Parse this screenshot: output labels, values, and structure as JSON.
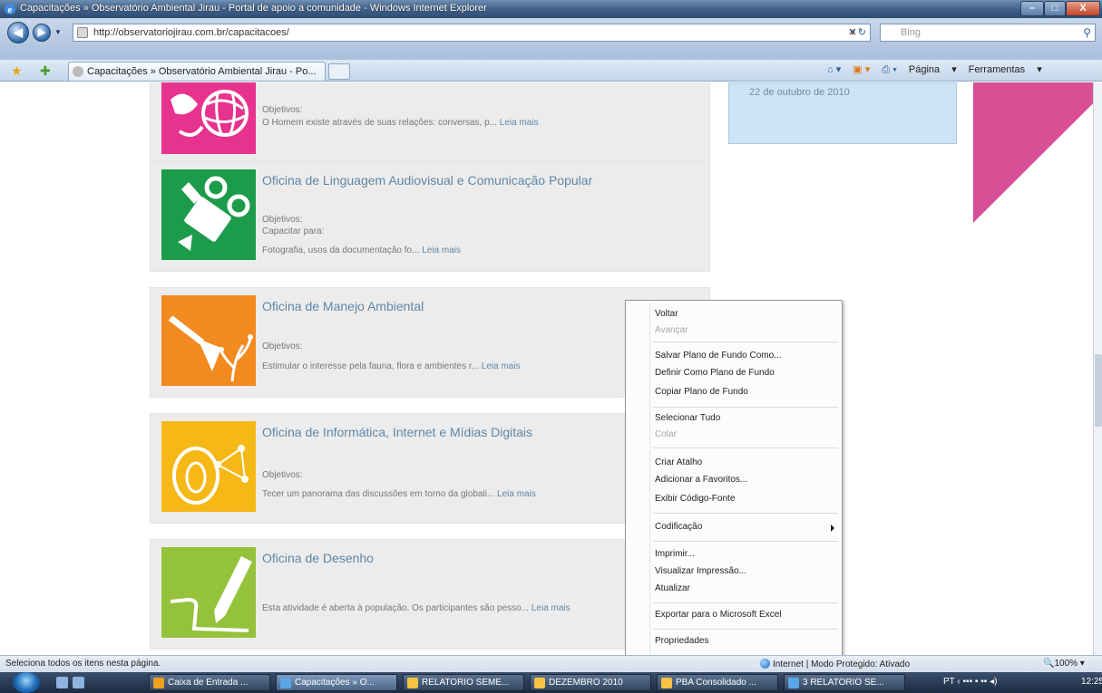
{
  "window": {
    "title": "Capacitações » Observatório Ambiental Jirau - Portal de apoio a comunidade - Windows Internet Explorer",
    "min_label": "–",
    "max_label": "□",
    "close_label": "X"
  },
  "addressbar": {
    "url": "http://observatoriojirau.com.br/capacitacoes/",
    "search_placeholder": "Bing"
  },
  "tab": {
    "label": "Capacitações » Observatório Ambiental Jirau - Po..."
  },
  "commandbar": {
    "page_label": "Página",
    "tools_label": "Ferramentas"
  },
  "sidebar": {
    "date": "22 de outubro de 2010"
  },
  "cards": [
    {
      "title": "",
      "objetivos_label": "Objetivos:",
      "line": "",
      "description": "O Homem existe através de suas relações: conversas, p...",
      "more": "Leia mais",
      "color": "#e6338e"
    },
    {
      "title": "Oficina de Linguagem Audiovisual e Comunicação Popular",
      "objetivos_label": "Objetivos:",
      "line": "Capacitar para:",
      "description": "Fotografia, usos da documentação fo...",
      "more": "Leia mais",
      "color": "#1c9c4a"
    },
    {
      "title": "Oficina de Manejo Ambiental",
      "objetivos_label": "Objetivos:",
      "line": "",
      "description": "Estimular o interesse pela fauna, flora e ambientes r...",
      "more": "Leia mais",
      "color": "#f28a1f"
    },
    {
      "title": "Oficina de Informática, Internet e Mídias Digitais",
      "objetivos_label": "Objetivos:",
      "line": "",
      "description": "Tecer um panorama das discussões em torno da globali...",
      "more": "Leia mais",
      "color": "#f5b816"
    },
    {
      "title": "Oficina de Desenho",
      "objetivos_label": "",
      "line": "",
      "description": "Esta atividade é aberta à população. Os participantes são pesso...",
      "more": "Leia mais",
      "color": "#94c23a"
    }
  ],
  "context_menu": {
    "items": [
      {
        "label": "Voltar",
        "enabled": true
      },
      {
        "label": "Avançar",
        "enabled": false
      },
      {
        "label": "Salvar Plano de Fundo Como...",
        "enabled": true
      },
      {
        "label": "Definir Como Plano de Fundo",
        "enabled": true
      },
      {
        "label": "Copiar Plano de Fundo",
        "enabled": true
      },
      {
        "label": "Selecionar Tudo",
        "enabled": true
      },
      {
        "label": "Colar",
        "enabled": false
      },
      {
        "label": "Criar Atalho",
        "enabled": true
      },
      {
        "label": "Adicionar a Favoritos...",
        "enabled": true
      },
      {
        "label": "Exibir Código-Fonte",
        "enabled": true
      },
      {
        "label": "Codificação",
        "enabled": true
      },
      {
        "label": "Imprimir...",
        "enabled": true
      },
      {
        "label": "Visualizar Impressão...",
        "enabled": true
      },
      {
        "label": "Atualizar",
        "enabled": true
      },
      {
        "label": "Exportar para o Microsoft Excel",
        "enabled": true
      },
      {
        "label": "Propriedades",
        "enabled": true
      }
    ]
  },
  "statusbar": {
    "message": "Seleciona todos os itens nesta página.",
    "zone": "Internet | Modo Protegido: Ativado",
    "zoom": "100%"
  },
  "taskbar": {
    "buttons": [
      {
        "label": "Caixa de Entrada ...",
        "color": "#f0a020"
      },
      {
        "label": "Capacitações » O...",
        "color": "#5ba6e8"
      },
      {
        "label": "RELATORIO SEME...",
        "color": "#f5c242"
      },
      {
        "label": "DEZEMBRO 2010",
        "color": "#f5c242"
      },
      {
        "label": "PBA Consolidado ...",
        "color": "#f5c242"
      },
      {
        "label": "3 RELATORIO SE...",
        "color": "#5ba6e8"
      }
    ],
    "lang": "PT",
    "clock": "12:25"
  },
  "colors": {
    "link": "#5e87a7",
    "card_bg": "#ececec",
    "sidebar_bg": "#cde4f4",
    "pink_band": "#d94f94"
  }
}
